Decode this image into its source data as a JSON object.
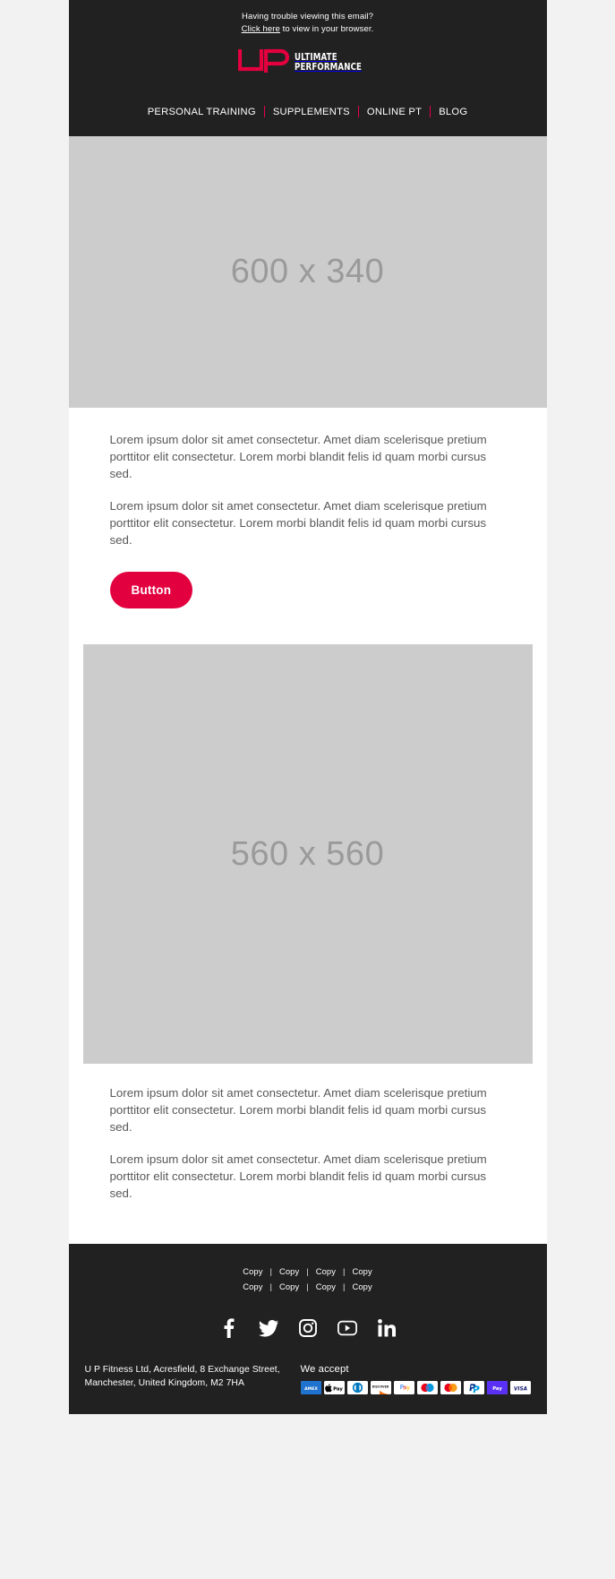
{
  "header": {
    "preheader_line1": "Having trouble viewing this email?",
    "preheader_link": "Click here",
    "preheader_line2": " to view in your browser.",
    "logo_word_top": "ULTIMATE",
    "logo_word_bottom": "PERFORMANCE",
    "logo_mark_color": "#e2003f",
    "background": "#212121",
    "nav": [
      {
        "label": "PERSONAL TRAINING"
      },
      {
        "label": "SUPPLEMENTS"
      },
      {
        "label": "ONLINE PT"
      },
      {
        "label": "BLOG"
      }
    ],
    "nav_separator_color": "#e2004b"
  },
  "hero": {
    "placeholder_label": "600 x 340",
    "background": "#cccccc",
    "text_color": "#9a9a9a"
  },
  "main": {
    "paragraph_1": "Lorem ipsum dolor sit amet consectetur. Amet diam scelerisque pretium porttitor elit consectetur. Lorem morbi blandit felis id quam morbi cursus sed.",
    "paragraph_2": "Lorem ipsum dolor sit amet consectetur. Amet diam scelerisque pretium porttitor elit consectetur. Lorem morbi blandit felis id quam morbi cursus sed.",
    "button_label": "Button",
    "button_color": "#e2003f",
    "square_placeholder_label": "560 x 560",
    "paragraph_3": "Lorem ipsum dolor sit amet consectetur. Amet diam scelerisque pretium porttitor elit consectetur. Lorem morbi blandit felis id quam morbi cursus sed.",
    "paragraph_4": "Lorem ipsum dolor sit amet consectetur. Amet diam scelerisque pretium porttitor elit consectetur. Lorem morbi blandit felis id quam morbi cursus sed.",
    "text_color": "#58585a"
  },
  "footer": {
    "background": "#212121",
    "copy_row_1": [
      "Copy",
      "Copy",
      "Copy",
      "Copy"
    ],
    "copy_row_2": [
      "Copy",
      "Copy",
      "Copy",
      "Copy"
    ],
    "separator": "|",
    "social": [
      {
        "name": "facebook-icon"
      },
      {
        "name": "twitter-icon"
      },
      {
        "name": "instagram-icon"
      },
      {
        "name": "youtube-icon"
      },
      {
        "name": "linkedin-icon"
      }
    ],
    "address": "U P Fitness Ltd, Acresfield, 8 Exchange Street, Manchester, United Kingdom, M2 7HA",
    "payment_title": "We accept",
    "payments": [
      {
        "name": "amex",
        "label": "AMEX"
      },
      {
        "name": "apple-pay",
        "label": "Pay"
      },
      {
        "name": "diners-club",
        "label": ""
      },
      {
        "name": "discover",
        "label": "DISCOVER"
      },
      {
        "name": "google-pay",
        "label": "Pay"
      },
      {
        "name": "maestro",
        "label": ""
      },
      {
        "name": "mastercard",
        "label": ""
      },
      {
        "name": "paypal",
        "label": "PayPal"
      },
      {
        "name": "shop-pay",
        "label": "Pay"
      },
      {
        "name": "visa",
        "label": "VISA"
      }
    ]
  }
}
